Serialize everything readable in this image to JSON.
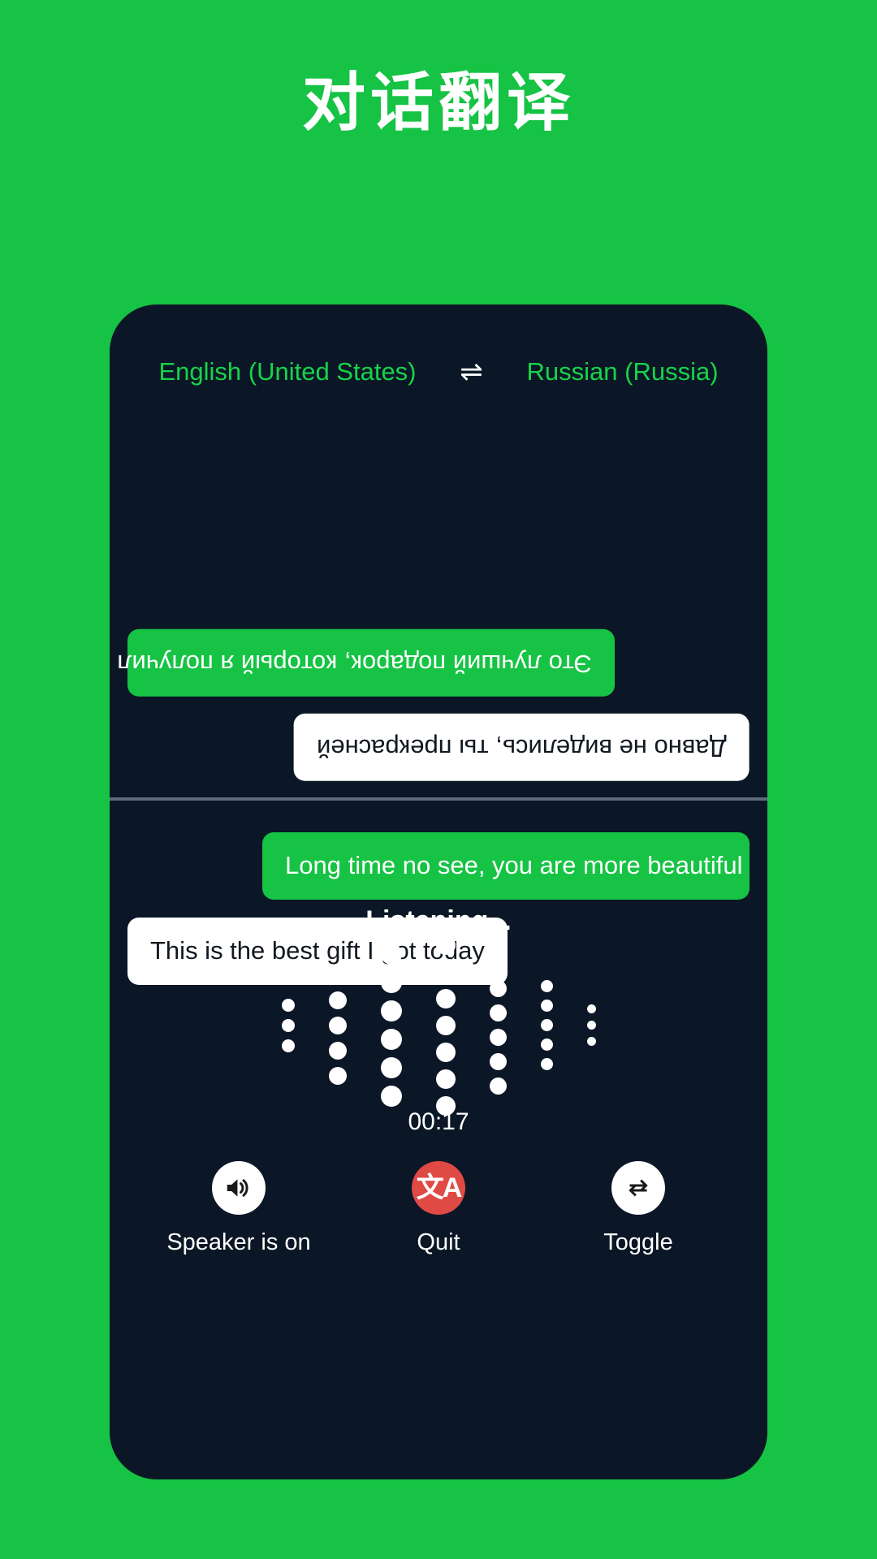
{
  "page": {
    "title": "对话翻译",
    "background_color": "#16c344",
    "card_color": "#0b1726"
  },
  "language_bar": {
    "source_language": "English (United States)",
    "swap_icon": "swap-horizontal-icon",
    "swap_glyph": "⇌",
    "target_language": "Russian (Russia)",
    "text_color": "#16d44a"
  },
  "conversation": {
    "top_pane": [
      {
        "text": "Это лучший подарок, который я получил сегодня",
        "style": "green",
        "align": "left",
        "rotated": true
      },
      {
        "text": "Давно не виделись, ты прекрасней",
        "style": "white",
        "align": "right",
        "rotated": true
      }
    ],
    "bottom_pane": [
      {
        "text": "Long time no see, you are more beautiful",
        "style": "green",
        "align": "right",
        "rotated": false
      },
      {
        "text": "This is the best gift I got today",
        "style": "white",
        "align": "left",
        "rotated": false
      }
    ]
  },
  "status": {
    "listening_label": "Listening...",
    "timer": "00:17"
  },
  "waveform": {
    "columns": [
      {
        "dots": 3,
        "size": 16
      },
      {
        "dots": 5,
        "size": 22
      },
      {
        "dots": 6,
        "size": 26
      },
      {
        "dots": 7,
        "size": 24
      },
      {
        "dots": 6,
        "size": 21
      },
      {
        "dots": 5,
        "size": 15
      },
      {
        "dots": 3,
        "size": 11
      }
    ],
    "dot_color": "#ffffff"
  },
  "controls": [
    {
      "label": "Speaker is on",
      "icon": "speaker-on-icon",
      "circle_color": "#ffffff",
      "name": "speaker-button"
    },
    {
      "label": "Quit",
      "icon": "translate-icon",
      "glyph": "文A",
      "circle_color": "#e04a45",
      "name": "quit-button"
    },
    {
      "label": "Toggle",
      "icon": "swap-repeat-icon",
      "circle_color": "#ffffff",
      "name": "toggle-button"
    }
  ]
}
